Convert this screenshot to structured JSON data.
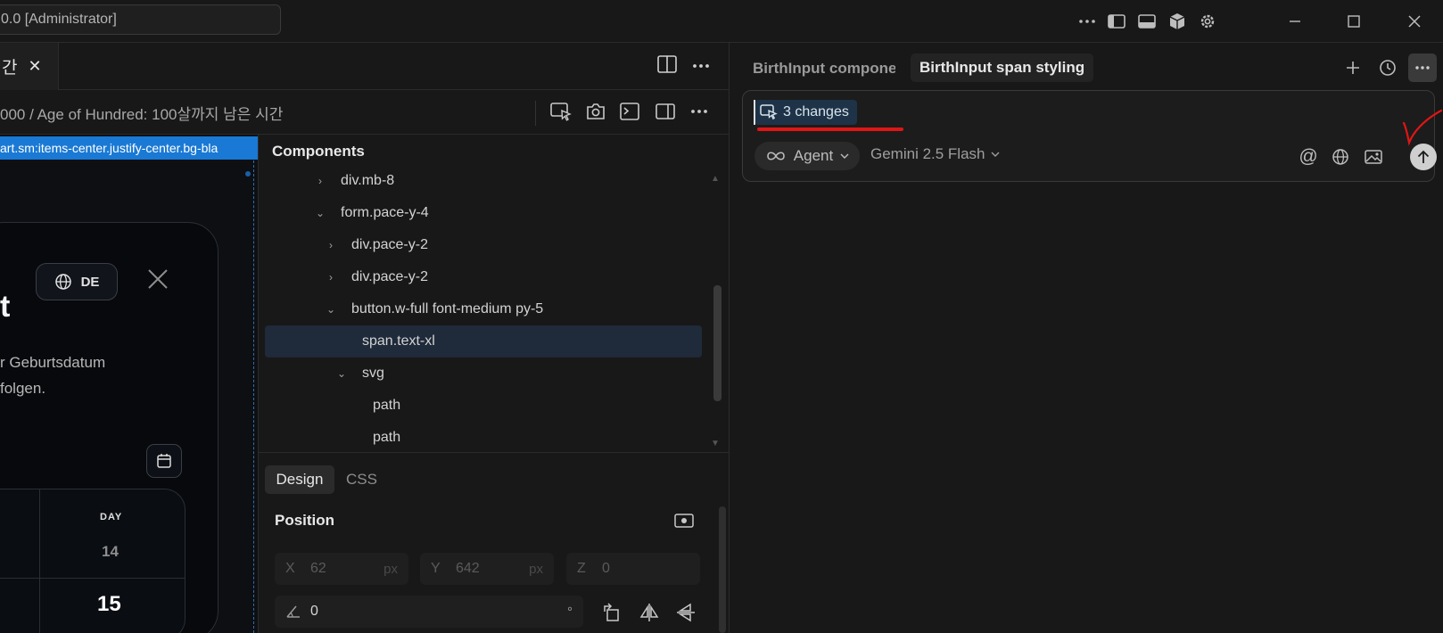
{
  "window": {
    "title": "0.0 [Administrator]"
  },
  "editor_tab": {
    "label": "간",
    "close_glyph": "✕"
  },
  "breadcrumb": "000 / Age of Hundred: 100살까지 남은 시간",
  "preview": {
    "selector": "art.sm:items-center.justify-center.bg-bla",
    "lang_label": "DE",
    "title_fragment": "t",
    "description_line1": "r Geburtsdatum",
    "description_line2": "folgen.",
    "day_header": "DAY",
    "day_prev": "14",
    "day_current": "15"
  },
  "components": {
    "title": "Components",
    "tree": [
      {
        "label": "div.mb-8",
        "chevron": "›",
        "depth": 0
      },
      {
        "label": "form.pace-y-4",
        "chevron": "⌄",
        "depth": 0
      },
      {
        "label": "div.pace-y-2",
        "chevron": "›",
        "depth": 1
      },
      {
        "label": "div.pace-y-2",
        "chevron": "›",
        "depth": 1
      },
      {
        "label": "button.w-full font-medium py-5",
        "chevron": "⌄",
        "depth": 1
      },
      {
        "label": "span.text-xl",
        "chevron": "",
        "depth": 2
      },
      {
        "label": "svg",
        "chevron": "⌄",
        "depth": 2
      },
      {
        "label": "path",
        "chevron": "",
        "depth": 3
      },
      {
        "label": "path",
        "chevron": "",
        "depth": 3
      }
    ]
  },
  "design": {
    "tabs": [
      "Design",
      "CSS"
    ],
    "section_title": "Position",
    "x": {
      "label": "X",
      "value": "62",
      "unit": "px"
    },
    "y": {
      "label": "Y",
      "value": "642",
      "unit": "px"
    },
    "z": {
      "label": "Z",
      "value": "0"
    },
    "rotation": {
      "value": "0",
      "unit": "°"
    }
  },
  "chat": {
    "tab1": "BirthInput compone",
    "tab2": "BirthInput span styling",
    "changes_label": "3 changes",
    "agent_label": "Agent",
    "model_label": "Gemini 2.5 Flash",
    "mention_glyph": "@"
  },
  "colors": {
    "accent_blue": "#1a79d4",
    "annotation_red": "#e01515",
    "selected_row": "#1f2a3a"
  }
}
